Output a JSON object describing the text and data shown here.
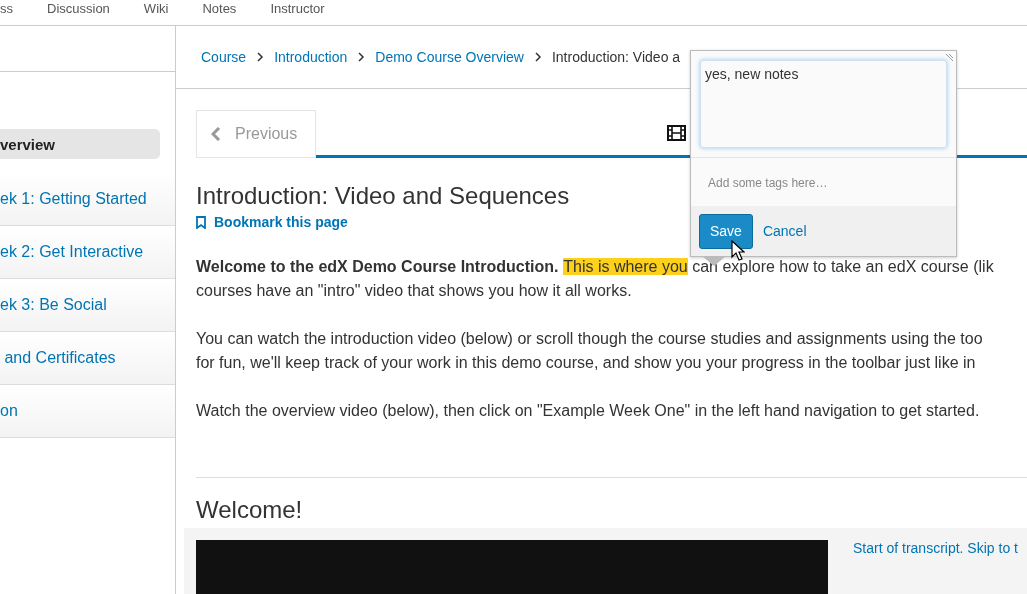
{
  "top_nav": [
    {
      "label": "ss"
    },
    {
      "label": "Discussion"
    },
    {
      "label": "Wiki"
    },
    {
      "label": "Notes"
    },
    {
      "label": "Instructor"
    }
  ],
  "sidebar": {
    "items": [
      {
        "label": "verview",
        "selected": true
      },
      {
        "label": "ek 1: Getting Started",
        "selected": false
      },
      {
        "label": "ek 2: Get Interactive",
        "selected": false
      },
      {
        "label": "ek 3: Be Social",
        "selected": false
      },
      {
        "label": " and Certificates",
        "selected": false
      },
      {
        "label": "on",
        "selected": false
      }
    ]
  },
  "breadcrumb": [
    {
      "label": "Course",
      "kind": "link"
    },
    {
      "label": "Introduction",
      "kind": "link"
    },
    {
      "label": "Demo Course Overview",
      "kind": "link"
    },
    {
      "label": "Introduction: Video a",
      "kind": "current"
    }
  ],
  "sequence_nav": {
    "previous": "Previous",
    "tabs": [
      {
        "kind": "video",
        "selected": true
      }
    ]
  },
  "unit": {
    "title": "Introduction: Video and Sequences",
    "bookmark": "Bookmark this page",
    "paragraphs": [
      {
        "lines": [
          [
            {
              "text": "Welcome to the edX Demo Course Introduction.",
              "kind": "bold"
            },
            {
              "text": "This is where you",
              "kind": "highlight"
            },
            {
              "text": " can explore how to take an edX course (lik",
              "kind": "plain"
            }
          ],
          [
            {
              "text": "courses have an \"intro\" video that shows you how it all works.",
              "kind": "plain"
            }
          ]
        ]
      },
      {
        "lines": [
          [
            {
              "text": "You can watch the introduction video (below) or scroll though the course studies and assignments using the too",
              "kind": "plain"
            }
          ],
          [
            {
              "text": "for fun, we'll keep track of your work in this demo course, and show you your progress in the toolbar just like in",
              "kind": "plain"
            }
          ]
        ]
      },
      {
        "lines": [
          [
            {
              "text": "Watch the overview video (below), then click on \"Example Week One\" in the left hand navigation to get started.",
              "kind": "plain"
            }
          ]
        ]
      }
    ],
    "section_title": "Welcome!",
    "transcript_link": "Start of transcript. Skip to t"
  },
  "note_editor": {
    "value": "yes, new notes",
    "tags_placeholder": "Add some tags here…",
    "save": "Save",
    "cancel": "Cancel"
  }
}
